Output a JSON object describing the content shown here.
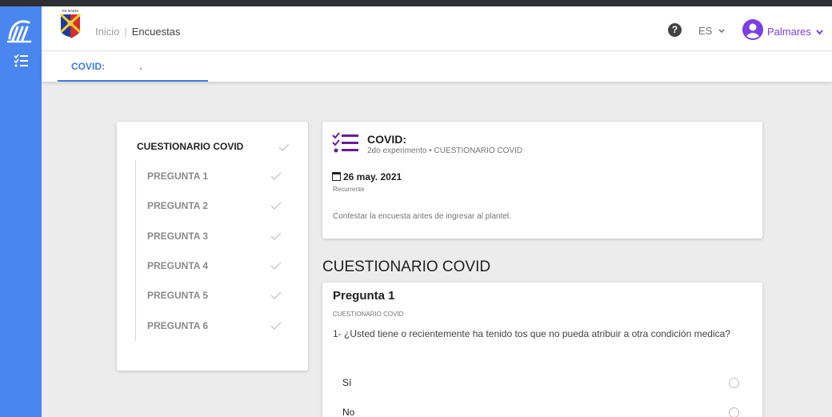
{
  "header": {
    "crest_text": "PALMARES",
    "breadcrumb": {
      "home": "Inicio",
      "separator": "|",
      "current": "Encuestas"
    },
    "help_label": "?",
    "language": "ES",
    "user": "Palmares"
  },
  "tabs": [
    {
      "label": "COVID:",
      "active": true
    }
  ],
  "stepper": {
    "main": "CUESTIONARIO COVID",
    "items": [
      "PREGUNTA 1",
      "PREGUNTA 2",
      "PREGUNTA 3",
      "PREGUNTA 4",
      "PREGUNTA 5",
      "PREGUNTA 6"
    ]
  },
  "survey": {
    "title": "COVID:",
    "subtitle": "2do experimento • CUESTIONARIO COVID",
    "date": "26 may. 2021",
    "frequency": "Recurrente",
    "description": "Contestar la encuesta antes de ingresar al plantel."
  },
  "section_title": "CUESTIONARIO COVID",
  "question": {
    "title": "Pregunta 1",
    "section": "CUESTIONARIO COVID",
    "text": "1- ¿Usted tiene o recientemente ha tenido tos que no pueda atribuir a otra condición medica?",
    "options": [
      "Sí",
      "No"
    ]
  },
  "colors": {
    "sidebar": "#4a86f0",
    "accent": "#3d7de4",
    "user": "#7b3fe4",
    "topstrip": "#2d2f33"
  },
  "icons": [
    "app-logo-icon",
    "menu-list-icon",
    "help-icon",
    "chevron-down-icon",
    "avatar-icon",
    "check-icon",
    "list-check-icon",
    "calendar-icon",
    "radio-icon"
  ]
}
